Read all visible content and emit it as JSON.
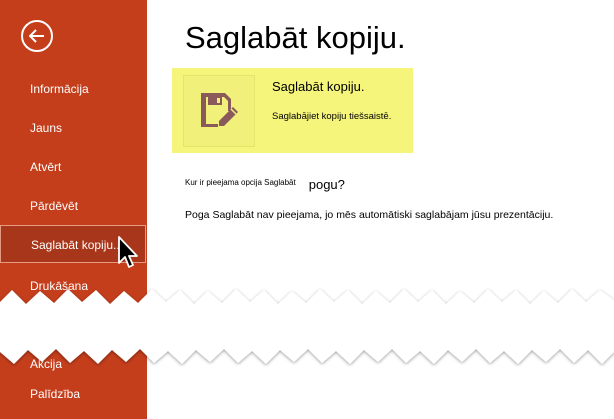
{
  "colors": {
    "sidebar": "#c43e1c",
    "sidebar_selected": "#a8361a",
    "highlight": "#f5f57c",
    "icon": "#8a5a5a"
  },
  "sidebar": {
    "back_icon": "back-arrow-icon",
    "items": [
      {
        "label": "Informācija"
      },
      {
        "label": "Jauns"
      },
      {
        "label": "Atvērt"
      },
      {
        "label": "Pārdēvēt"
      },
      {
        "label": "Saglabāt kopiju..."
      },
      {
        "label": "Drukāšana"
      },
      {
        "label": "Palīdzība"
      }
    ],
    "partial_label": "Akcija"
  },
  "main": {
    "title": "Saglabāt kopiju.",
    "save_option": {
      "icon": "save-edit-icon",
      "heading": "Saglabāt kopiju.",
      "description": "Saglabājiet kopiju tiešsaistē."
    },
    "question_small": "Kur ir pieejama opcija Saglabāt",
    "question_large": "pogu?",
    "answer": "Poga Saglabāt nav pieejama, jo mēs automātiski saglabājam jūsu prezentāciju."
  }
}
